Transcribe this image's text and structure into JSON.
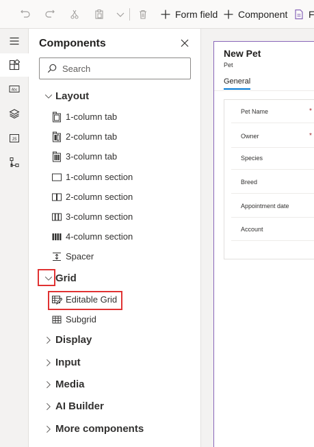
{
  "toolbar": {
    "form_field_label": "Form field",
    "component_label": "Component",
    "truncated_label": "Fo"
  },
  "rail": {
    "items": [
      {
        "icon": "hamburger-icon"
      },
      {
        "icon": "components-icon",
        "active": true
      },
      {
        "icon": "text-box-icon"
      },
      {
        "icon": "layers-icon"
      },
      {
        "icon": "js-file-icon"
      },
      {
        "icon": "tree-view-icon"
      }
    ]
  },
  "panel": {
    "title": "Components",
    "search_placeholder": "Search",
    "categories": {
      "layout": "Layout",
      "grid": "Grid",
      "display": "Display",
      "input": "Input",
      "media": "Media",
      "ai_builder": "AI Builder",
      "more": "More components"
    },
    "layout_items": [
      "1-column tab",
      "2-column tab",
      "3-column tab",
      "1-column section",
      "2-column section",
      "3-column section",
      "4-column section",
      "Spacer"
    ],
    "grid_items": [
      "Editable Grid",
      "Subgrid"
    ]
  },
  "form": {
    "title": "New Pet",
    "subtitle": "Pet",
    "tab": "General",
    "fields": [
      {
        "label": "Pet Name",
        "required": "*"
      },
      {
        "label": "Owner",
        "required": "*"
      },
      {
        "label": "Species",
        "required": ""
      },
      {
        "label": "Breed",
        "required": ""
      },
      {
        "label": "Appointment date",
        "required": ""
      },
      {
        "label": "Account",
        "required": ""
      }
    ]
  },
  "colors": {
    "highlight": "#e03131",
    "accent": "#0078d4",
    "form_border": "#8764b8"
  }
}
